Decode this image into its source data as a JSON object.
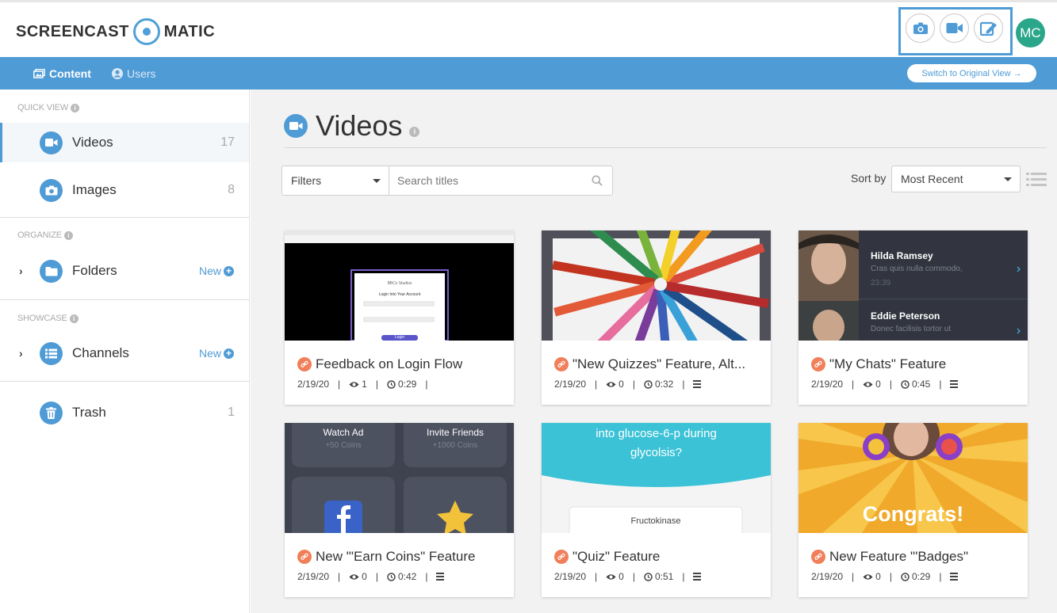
{
  "header": {
    "logo_left": "SCREENCAST",
    "logo_right": "MATIC",
    "tools": [
      "camera-icon",
      "video-camera-icon",
      "edit-icon"
    ],
    "avatar_initials": "MC",
    "avatar_color": "#2aa68a"
  },
  "topnav": {
    "items": [
      {
        "label": "Content",
        "icon": "content-icon"
      },
      {
        "label": "Users",
        "icon": "user-icon"
      }
    ],
    "switch_label": "Switch to Original View →"
  },
  "sidebar": {
    "quick_view_label": "QUICK VIEW",
    "organize_label": "ORGANIZE",
    "showcase_label": "SHOWCASE",
    "items": [
      {
        "label": "Videos",
        "count": "17",
        "icon": "video-icon"
      },
      {
        "label": "Images",
        "count": "8",
        "icon": "camera-icon"
      },
      {
        "label": "Folders",
        "new": "New",
        "icon": "folder-icon"
      },
      {
        "label": "Channels",
        "new": "New",
        "icon": "channel-list-icon"
      },
      {
        "label": "Trash",
        "count": "1",
        "icon": "trash-icon"
      }
    ]
  },
  "main": {
    "title": "Videos",
    "filters_label": "Filters",
    "search_placeholder": "Search titles",
    "sort_label": "Sort by",
    "sort_value": "Most Recent",
    "accent_color": "#4f9bd6",
    "link_color": "#f07f5a"
  },
  "cards": [
    {
      "title": "Feedback on Login Flow",
      "date": "2/19/20",
      "views": "1",
      "duration": "0:29"
    },
    {
      "title": "\"New Quizzes\" Feature, Alt...",
      "date": "2/19/20",
      "views": "0",
      "duration": "0:32"
    },
    {
      "title": "\"My Chats\" Feature",
      "date": "2/19/20",
      "views": "0",
      "duration": "0:45"
    },
    {
      "title": "New \"'Earn Coins\" Feature",
      "date": "2/19/20",
      "views": "0",
      "duration": "0:42"
    },
    {
      "title": "\"Quiz\" Feature",
      "date": "2/19/20",
      "views": "0",
      "duration": "0:51"
    },
    {
      "title": "New Feature \"'Badges\"",
      "date": "2/19/20",
      "views": "0",
      "duration": "0:29"
    }
  ],
  "thumbs": {
    "login": {
      "brand": "BBCx Studios",
      "heading": "Login Into Your Account",
      "button": "Login"
    },
    "chats": [
      {
        "name": "Hilda Ramsey",
        "message": "Cras quis nulla commodo,",
        "time": "23:39"
      },
      {
        "name": "Eddie Peterson",
        "message": "Donec facilisis tortor ut"
      }
    ],
    "coins": [
      {
        "title": "Watch Ad",
        "sub": "+50 Coins"
      },
      {
        "title": "Invite Friends",
        "sub": "+1000 Coins"
      }
    ],
    "quiz": {
      "question_1": "into glucose-6-p during",
      "question_2": "glycolsis?",
      "answer": "Fructokinase"
    },
    "badges": {
      "text": "Congrats!"
    }
  }
}
